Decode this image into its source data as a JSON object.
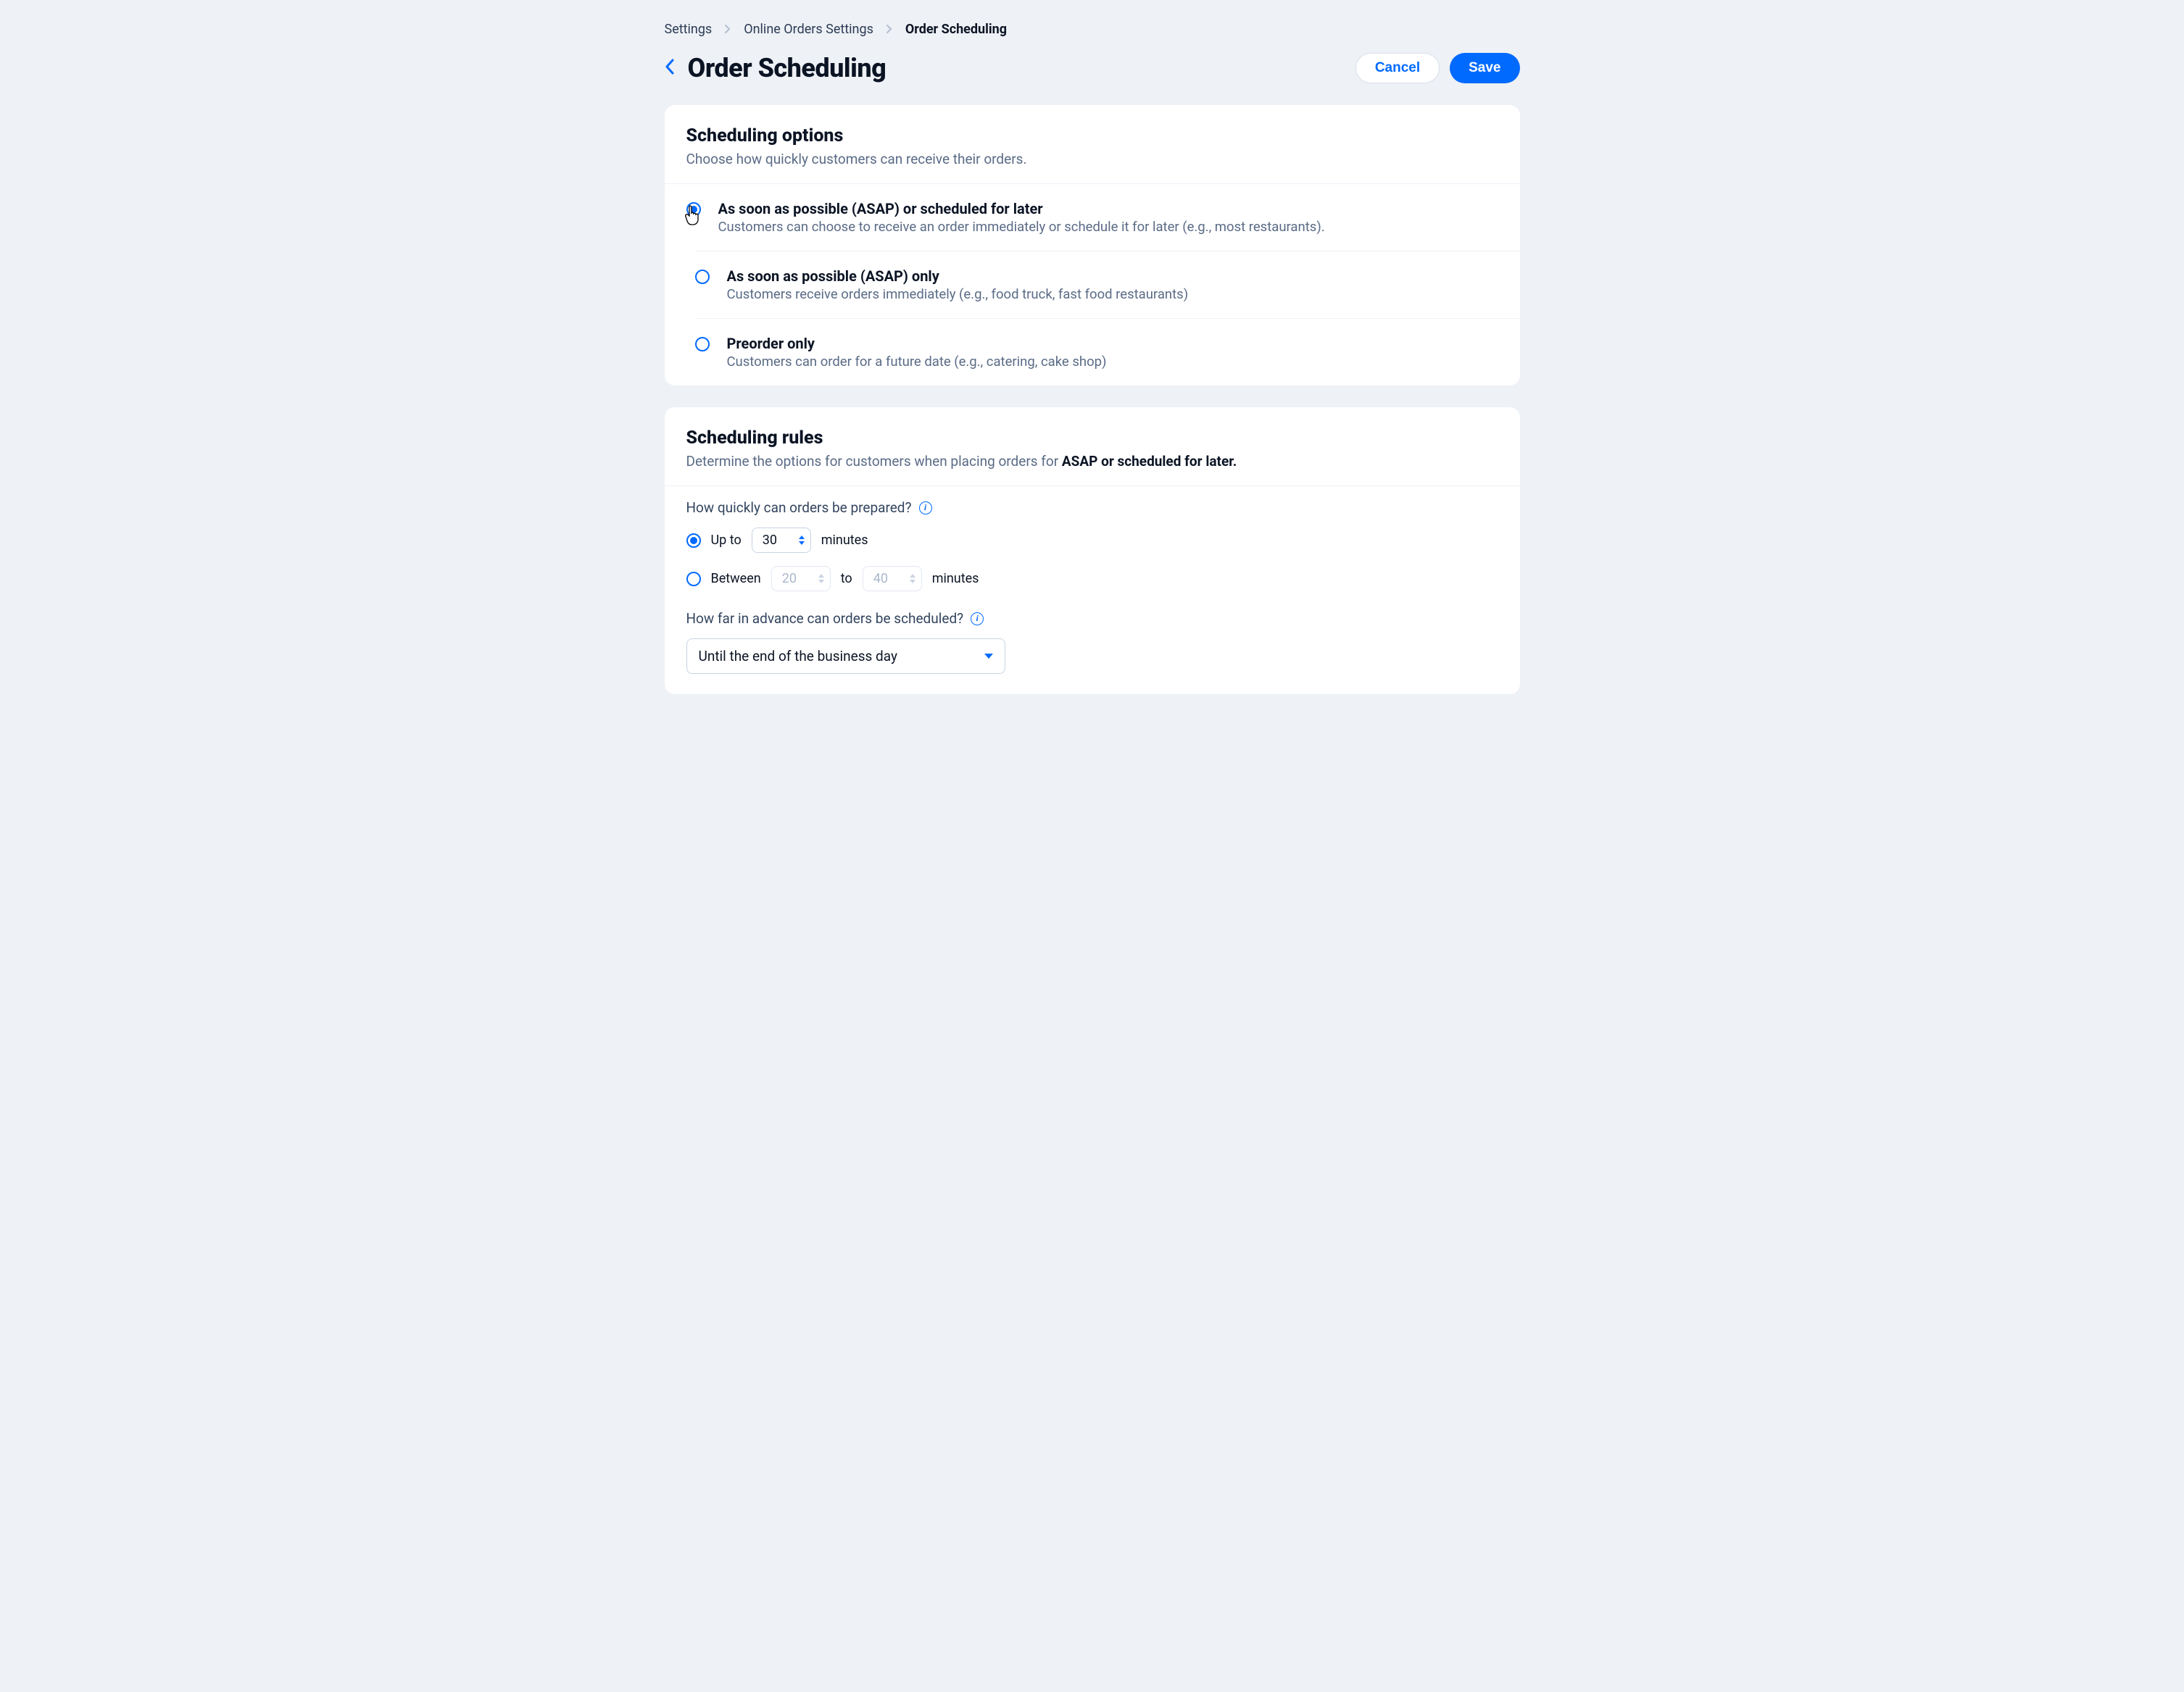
{
  "breadcrumb": {
    "items": [
      "Settings",
      "Online Orders Settings",
      "Order Scheduling"
    ]
  },
  "header": {
    "title": "Order Scheduling",
    "cancel": "Cancel",
    "save": "Save"
  },
  "scheduling_options": {
    "title": "Scheduling options",
    "subtitle": "Choose how quickly customers can receive their orders.",
    "items": [
      {
        "title": "As soon as possible (ASAP) or scheduled for later",
        "desc": "Customers can choose to receive an order immediately or schedule it for later (e.g., most restaurants).",
        "selected": true
      },
      {
        "title": "As soon as possible (ASAP)  only",
        "desc": "Customers receive orders immediately (e.g., food truck, fast food restaurants)",
        "selected": false
      },
      {
        "title": "Preorder only",
        "desc": "Customers can order for a future date (e.g., catering, cake shop)",
        "selected": false
      }
    ]
  },
  "scheduling_rules": {
    "title": "Scheduling rules",
    "subtitle_prefix": "Determine the options for customers when placing orders for ",
    "subtitle_bold": "ASAP or scheduled for later.",
    "prep_question": "How quickly can orders be prepared?",
    "upto_label": "Up to",
    "upto_value": "30",
    "minutes_label": "minutes",
    "between_label": "Between",
    "between_low": "20",
    "to_label": "to",
    "between_high": "40",
    "advance_question": "How far in advance can orders be scheduled?",
    "advance_value": "Until the end of the business day"
  }
}
